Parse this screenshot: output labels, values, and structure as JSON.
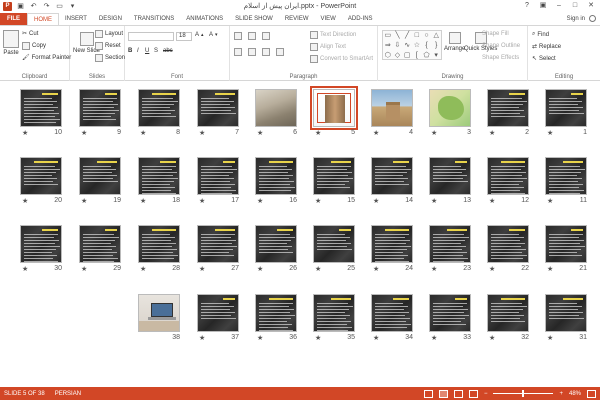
{
  "window": {
    "title": "ایران پیش از اسلام.pptx - PowerPoint",
    "app_icon": "P",
    "signin": "Sign in"
  },
  "tabs": [
    "FILE",
    "HOME",
    "INSERT",
    "DESIGN",
    "TRANSITIONS",
    "ANIMATIONS",
    "SLIDE SHOW",
    "REVIEW",
    "VIEW",
    "ADD-INS"
  ],
  "ribbon": {
    "clipboard": {
      "label": "Clipboard",
      "paste": "Paste",
      "cut": "Cut",
      "copy": "Copy",
      "format_painter": "Format Painter"
    },
    "slides": {
      "label": "Slides",
      "new_slide": "New Slide",
      "layout": "Layout",
      "reset": "Reset",
      "section": "Section"
    },
    "font": {
      "label": "Font",
      "size": "18",
      "bold": "B",
      "italic": "I",
      "underline": "U",
      "shadow": "S",
      "strike": "abc"
    },
    "paragraph": {
      "label": "Paragraph",
      "text_direction": "Text Direction",
      "align_text": "Align Text",
      "smartart": "Convert to SmartArt"
    },
    "drawing": {
      "label": "Drawing",
      "arrange": "Arrange",
      "quick_styles": "Quick Styles",
      "shape_fill": "Shape Fill",
      "shape_outline": "Shape Outline",
      "shape_effects": "Shape Effects"
    },
    "editing": {
      "label": "Editing",
      "find": "Find",
      "replace": "Replace",
      "select": "Select"
    }
  },
  "slides": [
    {
      "number": "1",
      "kind": "title"
    },
    {
      "number": "2",
      "kind": "text"
    },
    {
      "number": "3",
      "kind": "map"
    },
    {
      "number": "4",
      "kind": "tomb"
    },
    {
      "number": "5",
      "kind": "column",
      "selected": true
    },
    {
      "number": "6",
      "kind": "ruins"
    },
    {
      "number": "7",
      "kind": "text"
    },
    {
      "number": "8",
      "kind": "text"
    },
    {
      "number": "9",
      "kind": "text"
    },
    {
      "number": "10",
      "kind": "text"
    },
    {
      "number": "11",
      "kind": "text"
    },
    {
      "number": "12",
      "kind": "text"
    },
    {
      "number": "13",
      "kind": "text"
    },
    {
      "number": "14",
      "kind": "text"
    },
    {
      "number": "15",
      "kind": "text"
    },
    {
      "number": "16",
      "kind": "text"
    },
    {
      "number": "17",
      "kind": "text"
    },
    {
      "number": "18",
      "kind": "text"
    },
    {
      "number": "19",
      "kind": "text"
    },
    {
      "number": "20",
      "kind": "text"
    },
    {
      "number": "21",
      "kind": "text"
    },
    {
      "number": "22",
      "kind": "text"
    },
    {
      "number": "23",
      "kind": "text"
    },
    {
      "number": "24",
      "kind": "text"
    },
    {
      "number": "25",
      "kind": "text"
    },
    {
      "number": "26",
      "kind": "text"
    },
    {
      "number": "27",
      "kind": "text"
    },
    {
      "number": "28",
      "kind": "text"
    },
    {
      "number": "29",
      "kind": "text"
    },
    {
      "number": "30",
      "kind": "text"
    },
    {
      "number": "31",
      "kind": "text"
    },
    {
      "number": "32",
      "kind": "text"
    },
    {
      "number": "33",
      "kind": "text"
    },
    {
      "number": "34",
      "kind": "text"
    },
    {
      "number": "35",
      "kind": "text"
    },
    {
      "number": "36",
      "kind": "text"
    },
    {
      "number": "37",
      "kind": "text"
    },
    {
      "number": "38",
      "kind": "laptop"
    }
  ],
  "transition_marker": "★",
  "status": {
    "slide_info": "SLIDE 5 OF 38",
    "language": "PERSIAN",
    "zoom": "48%",
    "zoom_minus": "−",
    "zoom_plus": "+",
    "zoom_level": 0.48
  }
}
